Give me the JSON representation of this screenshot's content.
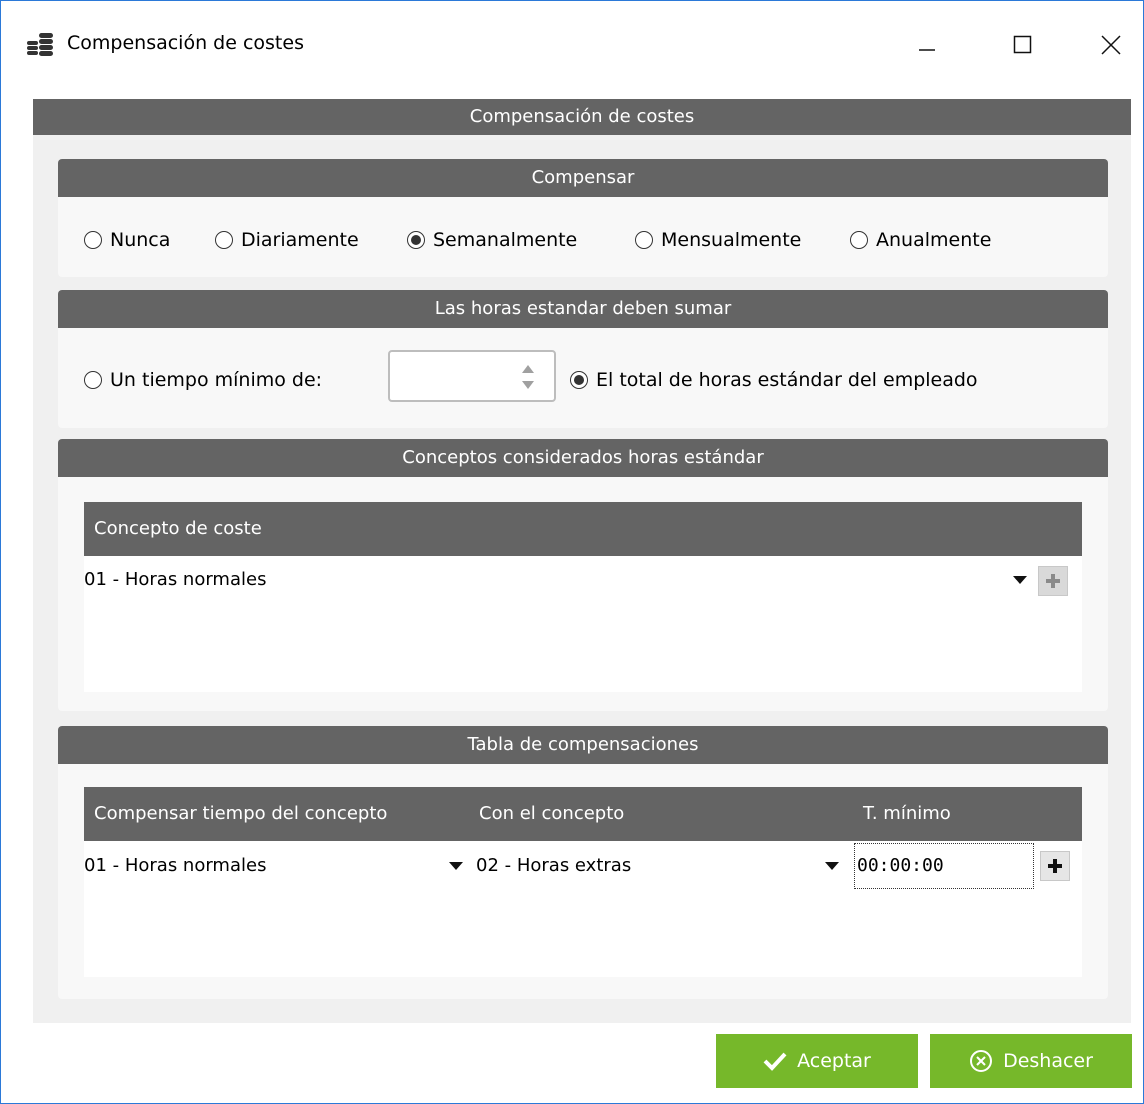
{
  "window": {
    "title": "Compensación de costes",
    "controls": {
      "minimize_icon": "minimize-icon",
      "maximize_icon": "maximize-icon",
      "close_icon": "close-icon"
    }
  },
  "main_header": "Compensación de costes",
  "compensar": {
    "header": "Compensar",
    "options": [
      {
        "label": "Nunca",
        "checked": false
      },
      {
        "label": "Diariamente",
        "checked": false
      },
      {
        "label": "Semanalmente",
        "checked": true
      },
      {
        "label": "Mensualmente",
        "checked": false
      },
      {
        "label": "Anualmente",
        "checked": false
      }
    ]
  },
  "horas": {
    "header": "Las horas estandar deben sumar",
    "option_min_label": "Un tiempo mínimo de:",
    "option_min_checked": false,
    "min_value": "",
    "option_total_label": "El total de horas estándar del empleado",
    "option_total_checked": true
  },
  "conceptos": {
    "header": "Conceptos considerados horas estándar",
    "column": "Concepto de coste",
    "rows": [
      {
        "concept": "01 - Horas normales"
      }
    ]
  },
  "tabla": {
    "header": "Tabla de compensaciones",
    "columns": [
      "Compensar tiempo del concepto",
      "Con el concepto",
      "T. mínimo"
    ],
    "rows": [
      {
        "from": "01 - Horas normales",
        "to": "02 - Horas extras",
        "min": "00:00:00"
      }
    ]
  },
  "buttons": {
    "accept": "Aceptar",
    "undo": "Deshacer"
  },
  "colors": {
    "header_bg": "#646464",
    "button_green": "#76b82a",
    "window_border": "#2b79d8"
  }
}
